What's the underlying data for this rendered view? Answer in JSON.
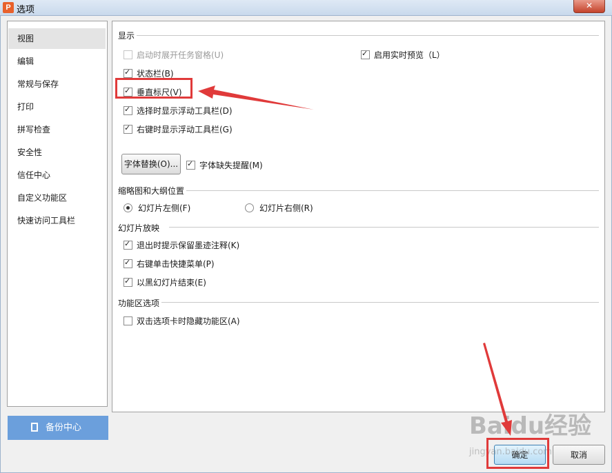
{
  "window": {
    "title": "选项",
    "app_icon_letter": "P",
    "close_glyph": "✕"
  },
  "sidebar": {
    "items": [
      {
        "label": "视图",
        "active": true
      },
      {
        "label": "编辑"
      },
      {
        "label": "常规与保存"
      },
      {
        "label": "打印"
      },
      {
        "label": "拼写检查"
      },
      {
        "label": "安全性"
      },
      {
        "label": "信任中心"
      },
      {
        "label": "自定义功能区"
      },
      {
        "label": "快速访问工具栏"
      }
    ]
  },
  "backup": {
    "label": "备份中心"
  },
  "display": {
    "title": "显示",
    "startup_taskpane": {
      "label": "启动时展开任务窗格(U)",
      "checked": false,
      "disabled": true
    },
    "live_preview": {
      "label": "启用实时预览（L）",
      "checked": true
    },
    "status_bar": {
      "label": "状态栏(B)",
      "checked": true
    },
    "vertical_ruler": {
      "label": "垂直标尺(V)",
      "checked": true
    },
    "float_toolbar_select": {
      "label": "选择时显示浮动工具栏(D)",
      "checked": true
    },
    "float_toolbar_rightclick": {
      "label": "右键时显示浮动工具栏(G)",
      "checked": true
    },
    "font_replace_button": "字体替换(O)...",
    "font_missing_tip": {
      "label": "字体缺失提醒(M)",
      "checked": true
    }
  },
  "thumbnail": {
    "title": "缩略图和大纲位置",
    "left": {
      "label": "幻灯片左侧(F)",
      "selected": true
    },
    "right": {
      "label": "幻灯片右侧(R)",
      "selected": false
    }
  },
  "slideshow": {
    "title": "幻灯片放映",
    "ink_prompt": {
      "label": "退出时提示保留墨迹注释(K)",
      "checked": true
    },
    "right_click_menu": {
      "label": "右键单击快捷菜单(P)",
      "checked": true
    },
    "end_black": {
      "label": "以黑幻灯片结束(E)",
      "checked": true
    }
  },
  "ribbon": {
    "title": "功能区选项",
    "hide_on_dblclick": {
      "label": "双击选项卡时隐藏功能区(A)",
      "checked": false
    }
  },
  "footer": {
    "ok_label": "确定",
    "cancel_label": "取消"
  },
  "watermark": {
    "logo": "Baidu经验",
    "url": "jingyan.baidu.com"
  },
  "annotation_color": "#e03a3a"
}
